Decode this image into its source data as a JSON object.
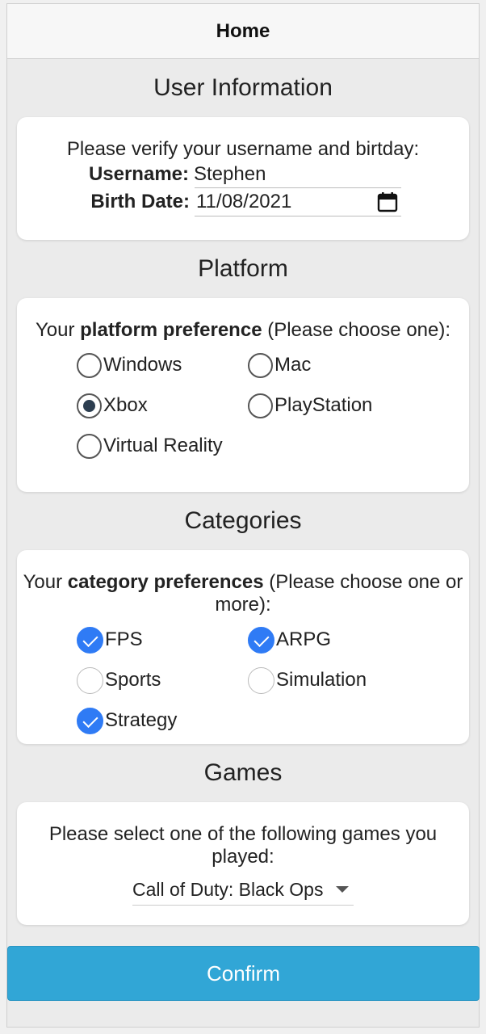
{
  "header": {
    "title": "Home"
  },
  "user_info": {
    "section_title": "User Information",
    "prompt": "Please verify your username and birtday:",
    "username_label": "Username:",
    "username_value": "Stephen",
    "birth_label": "Birth Date:",
    "birth_value": "11/08/2021",
    "calendar_icon": "calendar-icon"
  },
  "platform": {
    "section_title": "Platform",
    "prompt_pre": "Your ",
    "prompt_bold": "platform preference",
    "prompt_post": " (Please choose one):",
    "options": [
      {
        "label": "Windows",
        "selected": false
      },
      {
        "label": "Mac",
        "selected": false
      },
      {
        "label": "Xbox",
        "selected": true
      },
      {
        "label": "PlayStation",
        "selected": false
      },
      {
        "label": "Virtual Reality",
        "selected": false
      }
    ]
  },
  "categories": {
    "section_title": "Categories",
    "prompt_pre": "Your ",
    "prompt_bold": "category preferences",
    "prompt_post": " (Please choose one or more):",
    "options": [
      {
        "label": "FPS",
        "checked": true
      },
      {
        "label": "ARPG",
        "checked": true
      },
      {
        "label": "Sports",
        "checked": false
      },
      {
        "label": "Simulation",
        "checked": false
      },
      {
        "label": "Strategy",
        "checked": true
      }
    ]
  },
  "games": {
    "section_title": "Games",
    "prompt": "Please select one of the following games you played:",
    "selected": "Call of Duty: Black Ops"
  },
  "confirm_label": "Confirm",
  "colors": {
    "accent": "#31a6d6",
    "check": "#2f7bf5"
  }
}
